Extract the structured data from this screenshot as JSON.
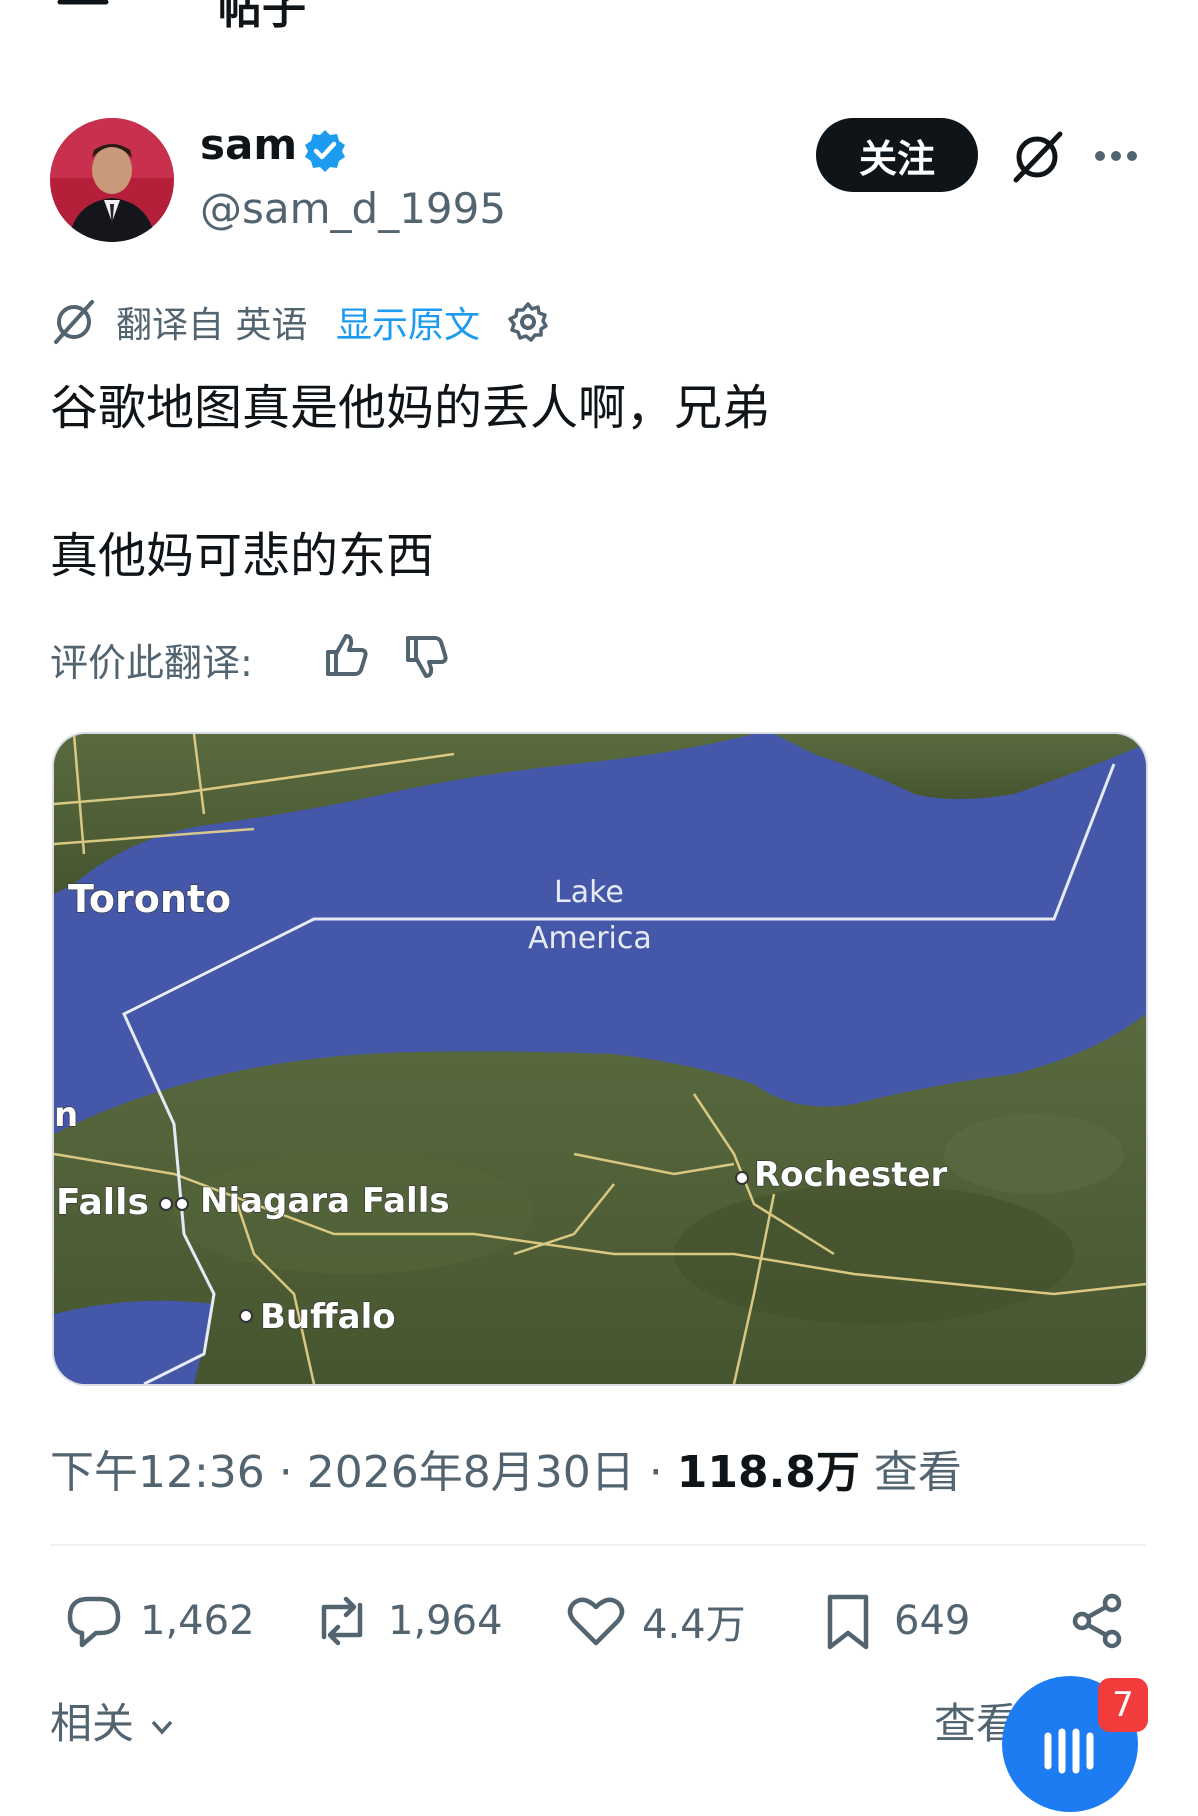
{
  "header": {
    "title": "帖子",
    "back_icon": "back-arrow-icon"
  },
  "author": {
    "name": "sam",
    "handle": "@sam_d_1995",
    "verified_color": "#1d9bf0",
    "follow_label": "关注"
  },
  "translation": {
    "label": "翻译自 英语",
    "show_original": "显示原文",
    "rate_label": "评价此翻译:"
  },
  "post": {
    "lines": [
      "谷歌地图真是他妈的丢人啊，兄弟",
      "真他妈可悲的东西"
    ]
  },
  "map": {
    "lake_line1": "Lake",
    "lake_line2": "America",
    "cities": {
      "toronto": "Toronto",
      "rochester": "Rochester",
      "niagara_falls": "Niagara Falls",
      "falls": "Falls",
      "buffalo": "Buffalo",
      "partial": "n"
    },
    "colors": {
      "water": "#4457a8",
      "land": "#4f5e38",
      "roads": "#e8d48a"
    }
  },
  "meta": {
    "time": "下午12:36",
    "date": "2026年8月30日",
    "views_count": "118.8万",
    "views_label": "查看"
  },
  "actions": {
    "replies": "1,462",
    "reposts": "1,964",
    "likes": "4.4万",
    "bookmarks": "649"
  },
  "footer": {
    "related": "相关",
    "see_more": "查看",
    "badge": "7"
  }
}
